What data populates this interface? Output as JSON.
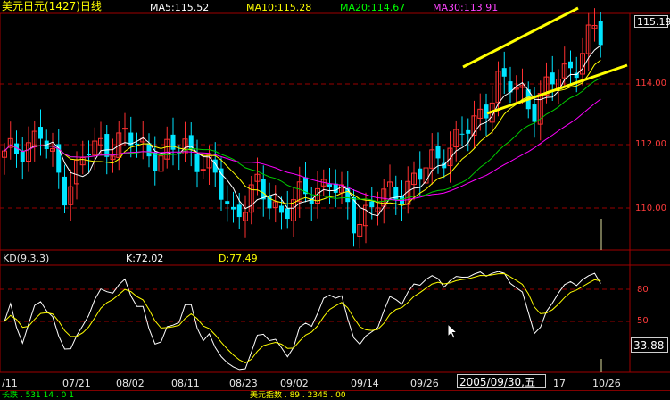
{
  "header": {
    "title": "美元日元(1427)日线",
    "ma5": "MA5:115.52",
    "ma10": "MA10:115.28",
    "ma20": "MA20:114.67",
    "ma30": "MA30:113.91"
  },
  "colors": {
    "up": "#ff3030",
    "down": "#00e5ff",
    "ma5": "#ffffff",
    "ma10": "#ffff00",
    "ma20": "#00cc00",
    "ma30": "#ff00ff",
    "grid": "#990000",
    "trend": "#ffff00"
  },
  "price_axis": {
    "current": "115.19",
    "ticks": [
      "114.00",
      "112.00",
      "110.00"
    ]
  },
  "kd_panel": {
    "title": "KD(9,3,3)",
    "k_value": "K:72.02",
    "d_value": "D:77.49",
    "ticks": [
      "80",
      "50"
    ],
    "current": "33.88"
  },
  "x_axis": {
    "labels": [
      "/11",
      "07/21",
      "08/02",
      "08/11",
      "08/23",
      "09/02",
      "09/14",
      "09/26",
      "17",
      "10/26"
    ],
    "cursor_date": "2005/09/30,五"
  },
  "bottom_bar": {
    "items": [
      "长跌 . 531 14 . 0 1",
      "",
      "",
      "",
      "",
      "美元指数 . 89 . 2345 . 00"
    ]
  }
}
